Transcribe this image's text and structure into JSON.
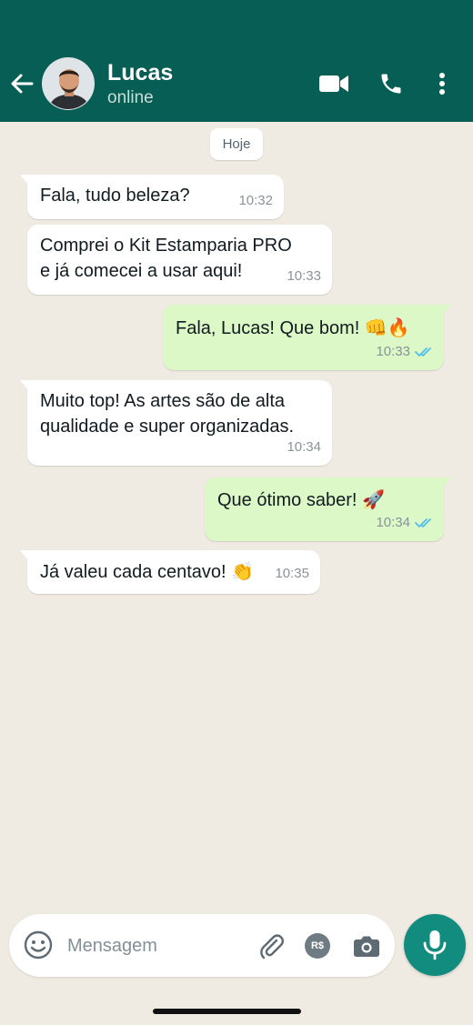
{
  "header": {
    "contact_name": "Lucas",
    "status": "online",
    "background_color": "#075e54"
  },
  "icons": {
    "back": "arrow-left-icon",
    "video": "video-camera-icon",
    "call": "phone-icon",
    "menu": "more-vertical-icon",
    "emoji": "emoji-icon",
    "attach": "paperclip-icon",
    "camera": "camera-icon",
    "mic": "microphone-icon"
  },
  "chat": {
    "date_label": "Hoje",
    "messages": [
      {
        "direction": "in",
        "text": "Fala, tudo beleza?",
        "time": "10:32"
      },
      {
        "direction": "in",
        "text": "Comprei o Kit Estamparia PRO\ne já comecei a usar aqui!",
        "time": "10:33"
      },
      {
        "direction": "out",
        "text": "Fala, Lucas! Que bom! 👊🔥",
        "time": "10:33",
        "status": "read"
      },
      {
        "direction": "in",
        "text": "Muito top! As artes são de alta\nqualidade e super organizadas.",
        "time": "10:34"
      },
      {
        "direction": "out",
        "text": "Que ótimo saber! 🚀",
        "time": "10:34",
        "status": "read"
      },
      {
        "direction": "in",
        "text": "Já valeu cada centavo! 👏",
        "time": "10:35"
      }
    ]
  },
  "composer": {
    "placeholder": "Mensagem",
    "pay_label": "R$"
  },
  "colors": {
    "outgoing_bubble": "#dcf8c6",
    "incoming_bubble": "#ffffff",
    "chat_background": "#efeae2",
    "read_tick": "#53bdeb",
    "mic_button": "#128c7e"
  }
}
